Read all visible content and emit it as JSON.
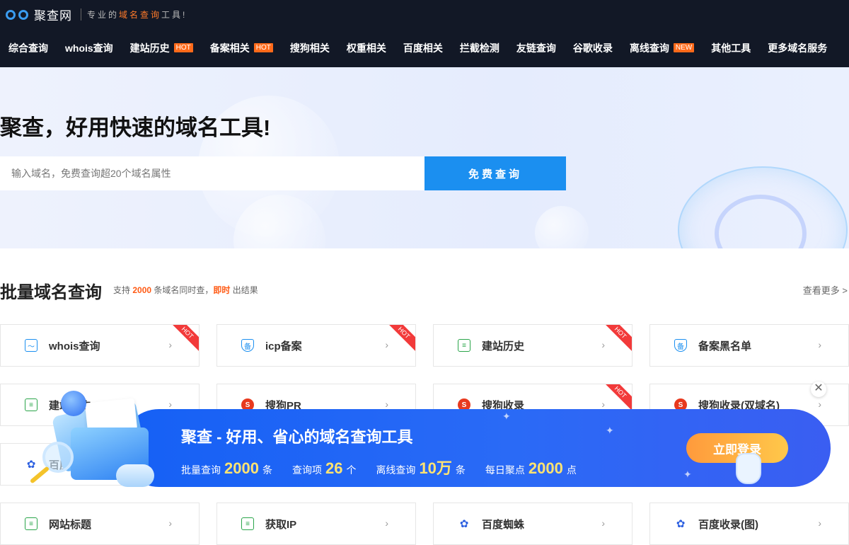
{
  "header": {
    "logo_name": "聚查网",
    "slogan_pre": "专业的",
    "slogan_hl": "域名查询",
    "slogan_post": "工具!"
  },
  "nav": {
    "items": [
      {
        "label": "综合查询",
        "badge": ""
      },
      {
        "label": "whois查询",
        "badge": ""
      },
      {
        "label": "建站历史",
        "badge": "HOT"
      },
      {
        "label": "备案相关",
        "badge": "HOT"
      },
      {
        "label": "搜狗相关",
        "badge": ""
      },
      {
        "label": "权重相关",
        "badge": ""
      },
      {
        "label": "百度相关",
        "badge": ""
      },
      {
        "label": "拦截检测",
        "badge": ""
      },
      {
        "label": "友链查询",
        "badge": ""
      },
      {
        "label": "谷歌收录",
        "badge": ""
      },
      {
        "label": "离线查询",
        "badge": "NEW"
      },
      {
        "label": "其他工具",
        "badge": ""
      },
      {
        "label": "更多域名服务",
        "badge": ""
      }
    ]
  },
  "hero": {
    "title": "聚查，好用快速的域名工具!",
    "search_placeholder": "输入域名，免费查询超20个域名属性",
    "search_button": "免费查询"
  },
  "section": {
    "title": "批量域名查询",
    "sub_pre": "支持",
    "sub_num": "2000",
    "sub_mid": "条域名同时查，",
    "sub_hl": "即时",
    "sub_post": "出结果",
    "more": "查看更多 >"
  },
  "cards": [
    {
      "label": "whois查询",
      "icon": "monitor-icon",
      "hot": "HOT"
    },
    {
      "label": "icp备案",
      "icon": "shield-icon",
      "hot": "HOT"
    },
    {
      "label": "建站历史",
      "icon": "history-icon",
      "hot": "HOT"
    },
    {
      "label": "备案黑名单",
      "icon": "shield-icon",
      "hot": ""
    },
    {
      "label": "建站历史",
      "icon": "history-icon",
      "hot": ""
    },
    {
      "label": "搜狗PR",
      "icon": "sogou-icon",
      "hot": ""
    },
    {
      "label": "搜狗收录",
      "icon": "sogou-icon",
      "hot": "HOT"
    },
    {
      "label": "搜狗收录(双域名)",
      "icon": "sogou-icon",
      "hot": ""
    },
    {
      "label": "百度",
      "icon": "baidu-icon",
      "hot": ""
    },
    {
      "label": "网站标题",
      "icon": "history-icon",
      "hot": ""
    },
    {
      "label": "获取IP",
      "icon": "history-icon",
      "hot": ""
    },
    {
      "label": "百度蜘蛛",
      "icon": "baidu-icon",
      "hot": ""
    },
    {
      "label": "百度收录(图)",
      "icon": "baidu-icon",
      "hot": ""
    }
  ],
  "banner": {
    "title": "聚查 - 好用、省心的域名查询工具",
    "stats": [
      {
        "label": "批量查询",
        "num": "2000",
        "unit": "条"
      },
      {
        "label": "查询项",
        "num": "26",
        "unit": "个"
      },
      {
        "label": "离线查询",
        "num": "10万",
        "unit": "条"
      },
      {
        "label": "每日聚点",
        "num": "2000",
        "unit": "点"
      }
    ],
    "login": "立即登录"
  },
  "colors": {
    "accent": "#1b8ff0",
    "nav_bg": "#121826",
    "hot": "#ff6a1a",
    "banner": "#1560f5"
  }
}
